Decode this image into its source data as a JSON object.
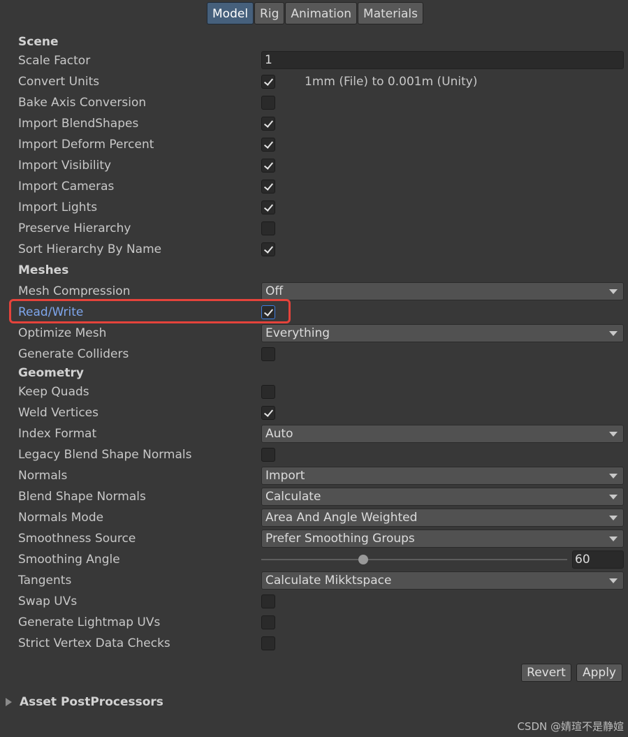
{
  "tabs": [
    "Model",
    "Rig",
    "Animation",
    "Materials"
  ],
  "active_tab": "Model",
  "scene": {
    "header": "Scene",
    "scale_factor_label": "Scale Factor",
    "scale_factor_value": "1",
    "convert_units_label": "Convert Units",
    "convert_units_note": "1mm (File) to 0.001m (Unity)",
    "bake_axis_label": "Bake Axis Conversion",
    "blendshapes_label": "Import BlendShapes",
    "deform_percent_label": "Import Deform Percent",
    "visibility_label": "Import Visibility",
    "cameras_label": "Import Cameras",
    "lights_label": "Import Lights",
    "preserve_hierarchy_label": "Preserve Hierarchy",
    "sort_hierarchy_label": "Sort Hierarchy By Name"
  },
  "meshes": {
    "header": "Meshes",
    "compression_label": "Mesh Compression",
    "compression_value": "Off",
    "read_write_label": "Read/Write",
    "optimize_label": "Optimize Mesh",
    "optimize_value": "Everything",
    "colliders_label": "Generate Colliders"
  },
  "geometry": {
    "header": "Geometry",
    "keep_quads_label": "Keep Quads",
    "weld_vertices_label": "Weld Vertices",
    "index_format_label": "Index Format",
    "index_format_value": "Auto",
    "legacy_blend_label": "Legacy Blend Shape Normals",
    "normals_label": "Normals",
    "normals_value": "Import",
    "blend_normals_label": "Blend Shape Normals",
    "blend_normals_value": "Calculate",
    "normals_mode_label": "Normals Mode",
    "normals_mode_value": "Area And Angle Weighted",
    "smoothness_source_label": "Smoothness Source",
    "smoothness_source_value": "Prefer Smoothing Groups",
    "smoothing_angle_label": "Smoothing Angle",
    "smoothing_angle_value": "60",
    "smoothing_angle_min": 0,
    "smoothing_angle_max": 180,
    "tangents_label": "Tangents",
    "tangents_value": "Calculate Mikktspace",
    "swap_uvs_label": "Swap UVs",
    "lightmap_uvs_label": "Generate Lightmap UVs",
    "strict_vertex_label": "Strict Vertex Data Checks"
  },
  "checkbox_states": {
    "convert_units": true,
    "bake_axis": false,
    "blendshapes": true,
    "deform_percent": true,
    "visibility": true,
    "cameras": true,
    "lights": true,
    "preserve_hierarchy": false,
    "sort_hierarchy": true,
    "read_write": true,
    "colliders": false,
    "keep_quads": false,
    "weld_vertices": true,
    "legacy_blend": false,
    "swap_uvs": false,
    "lightmap_uvs": false,
    "strict_vertex": false
  },
  "buttons": {
    "revert": "Revert",
    "apply": "Apply"
  },
  "foldout": {
    "label": "Asset PostProcessors"
  },
  "watermark": "CSDN @婧瑄不是静媗",
  "colors": {
    "highlight": "#e5433b",
    "active_tab": "#46607c",
    "link_label": "#7ea6ec"
  }
}
